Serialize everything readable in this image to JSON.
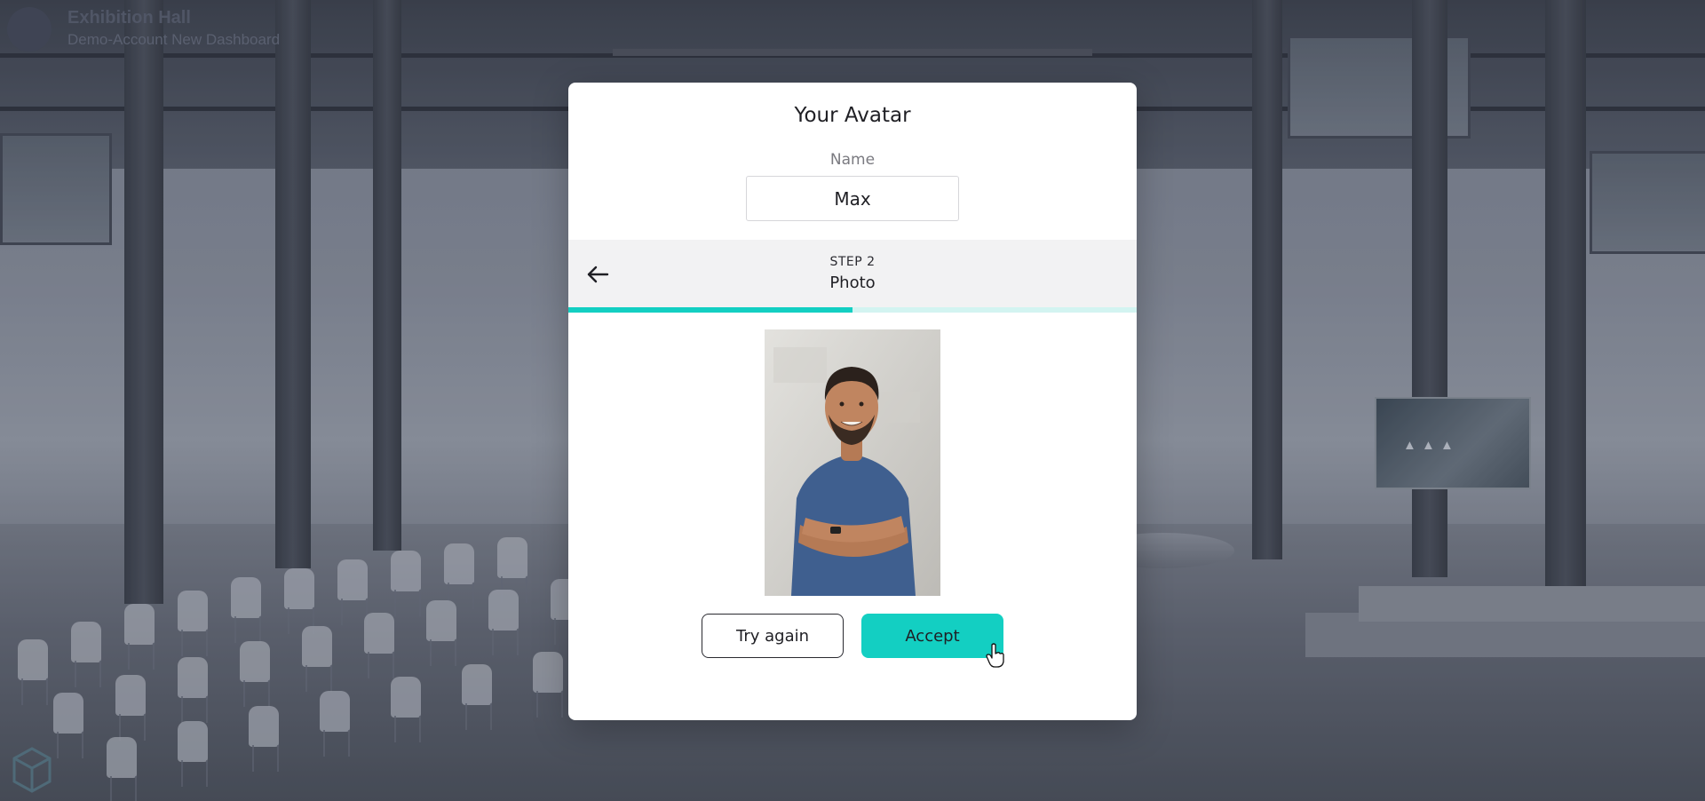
{
  "header": {
    "title": "Exhibition Hall",
    "subtitle": "Demo-Account New Dashboard"
  },
  "modal": {
    "title": "Your Avatar",
    "name_label": "Name",
    "name_value": "Max",
    "step": {
      "number_label": "STEP 2",
      "name": "Photo",
      "progress": 0.5
    },
    "buttons": {
      "try_again": "Try again",
      "accept": "Accept"
    }
  },
  "colors": {
    "accent": "#13cfc2",
    "progress_track": "#d3f4f1"
  },
  "icons": {
    "back": "arrow-left-icon",
    "logo": "cube-logo-icon"
  }
}
